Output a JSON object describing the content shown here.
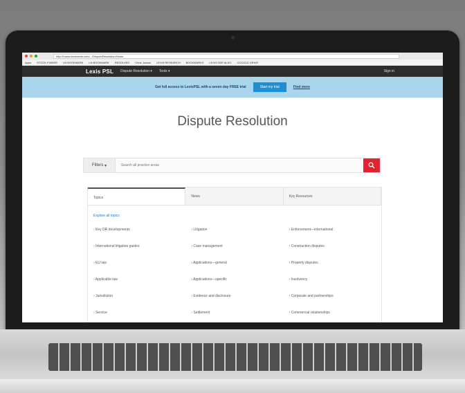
{
  "browser": {
    "url": "http://l.www.lexisnexis.com/.../DisputeResolution/Home",
    "bookmarks": [
      "Apps",
      "STOOK FINDER",
      "LN BOOKMARK",
      "LN BOOKMARK",
      "RESOLVED",
      "Chris Jordan",
      "LEXIS RESEARCH",
      "BOOKMARKS",
      "LEXIS SEE ALSO",
      "GOOGLE DRIVE"
    ]
  },
  "nav": {
    "brand": "Lexis PSL",
    "links": [
      "Dispute Resolution",
      "Tools"
    ],
    "signin": "Sign in"
  },
  "banner": {
    "text": "Get full access to LexisPSL with a seven day FREE trial",
    "button": "Start my trial",
    "link": "Find more"
  },
  "page": {
    "title": "Dispute Resolution"
  },
  "search": {
    "filters_label": "Filters",
    "placeholder": "Search all practice areas"
  },
  "tabs": [
    "Topics",
    "News",
    "Key Resources"
  ],
  "see_all": "Explore all topics",
  "topics": {
    "col1": [
      "Key DR developments",
      "International litigation guides",
      "EU law",
      "Applicable law",
      "Jurisdiction",
      "Service"
    ],
    "col2": [
      "Litigation",
      "Case management",
      "Applications—general",
      "Applications—specific",
      "Evidence and disclosure",
      "Settlement"
    ],
    "col3": [
      "Enforcement—international",
      "Construction disputes",
      "Property disputes",
      "Insolvency",
      "Corporate and partnerships",
      "Commercial relationships"
    ]
  },
  "colors": {
    "nav_bg": "#2d2d2d",
    "banner_bg": "#a9d6ec",
    "banner_button": "#1e8ed0",
    "search_button": "#e3222f"
  }
}
